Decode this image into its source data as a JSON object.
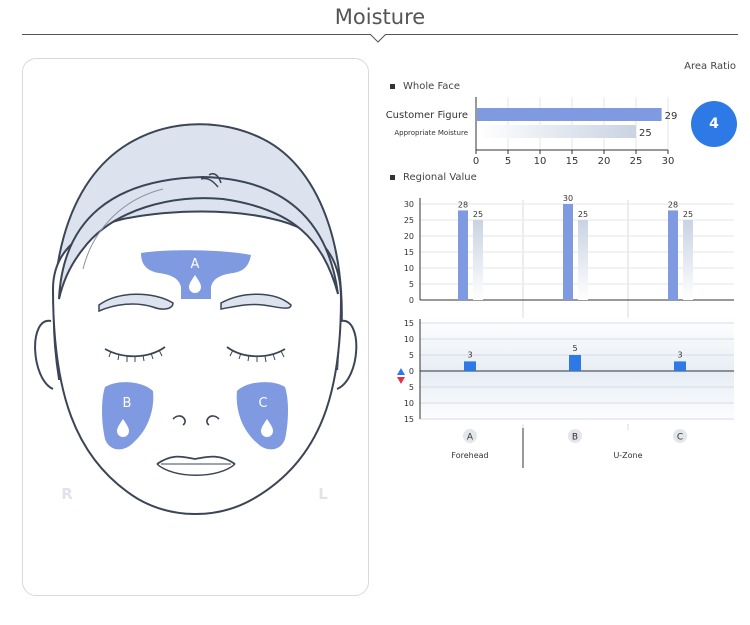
{
  "header": {
    "title": "Moisture"
  },
  "summary": {
    "area_ratio_label": "Area Ratio",
    "area_ratio_value": "4"
  },
  "face": {
    "zones": [
      {
        "letter": "A"
      },
      {
        "letter": "B"
      },
      {
        "letter": "C"
      }
    ],
    "side_right": "R",
    "side_left": "L"
  },
  "sections": {
    "whole_face": "Whole Face",
    "regional": "Regional Value"
  },
  "colors": {
    "accent": "#2d7ae6",
    "bar": "#7f9ae0",
    "zone": "#7f9ae0",
    "face_hair": "#dde3ee"
  },
  "chart_data": [
    {
      "type": "bar",
      "orientation": "horizontal",
      "categories": [
        "Customer Figure",
        "Appropriate Moisture"
      ],
      "values": [
        29,
        25
      ],
      "xlim": [
        0,
        30
      ],
      "xticks": [
        "0",
        "5",
        "10",
        "15",
        "20",
        "25",
        "30"
      ],
      "grid": true
    },
    {
      "type": "bar",
      "categories": [
        "A",
        "B",
        "C"
      ],
      "series": [
        {
          "values": [
            28,
            30,
            28
          ]
        },
        {
          "values": [
            25,
            25,
            25
          ]
        }
      ],
      "ylim": [
        0,
        30
      ],
      "yticks": [
        "0",
        "5",
        "10",
        "15",
        "20",
        "25",
        "30"
      ],
      "grid": true
    },
    {
      "type": "bar",
      "categories": [
        "A",
        "B",
        "C"
      ],
      "values": [
        3,
        5,
        3
      ],
      "ylim": [
        -15,
        15
      ],
      "yticks": [
        "15",
        "10",
        "5",
        "0",
        "5",
        "10",
        "15"
      ],
      "grid": true
    }
  ],
  "regions": {
    "groups": [
      "Forehead",
      "U-Zone"
    ]
  }
}
